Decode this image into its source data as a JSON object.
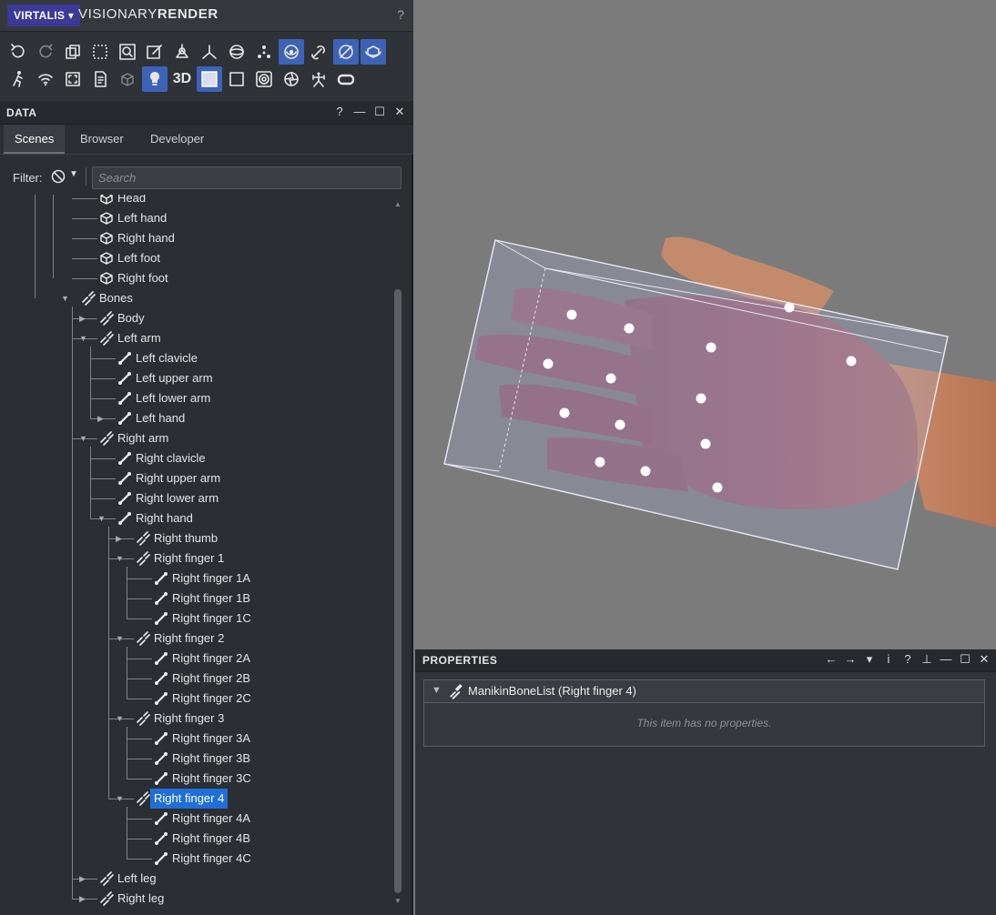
{
  "app": {
    "brand": "VIRTALIS",
    "brand_caret": "▾",
    "name_light": "VISIONARY",
    "name_bold": "RENDER",
    "help": "?"
  },
  "toolbar": {
    "row1": [
      "undo-icon",
      "redo-icon",
      "copy-icon",
      "marquee-select-icon",
      "zoom-select-icon",
      "edit-icon",
      "tree-icon",
      "axes-icon",
      "sphere-icon",
      "nodes-icon",
      "orbit-icon",
      "link-icon",
      "snap-icon",
      "cube-orbit-icon"
    ],
    "row1_active": [
      10,
      12,
      13
    ],
    "row2": [
      "walk-icon",
      "wifi-icon",
      "fit-icon",
      "document-icon",
      "box-icon",
      "light-icon",
      "3d-label",
      "solid-view-icon",
      "square-icon",
      "lens-icon",
      "shutter-icon",
      "skeleton-icon",
      "vr-headset-icon"
    ],
    "row2_active": [
      5,
      7
    ],
    "label_3d": "3D"
  },
  "data_panel": {
    "title": "DATA",
    "buttons": [
      "?",
      "—",
      "☐",
      "✕"
    ],
    "tabs": [
      {
        "label": "Scenes",
        "active": true
      },
      {
        "label": "Browser",
        "active": false
      },
      {
        "label": "Developer",
        "active": false
      }
    ],
    "filter_label": "Filter:",
    "search_placeholder": "Search"
  },
  "tree": [
    {
      "label": "Head",
      "icon": "mesh",
      "depth": 3,
      "arrow": ""
    },
    {
      "label": "Left hand",
      "icon": "mesh",
      "depth": 3,
      "arrow": ""
    },
    {
      "label": "Right hand",
      "icon": "mesh",
      "depth": 3,
      "arrow": ""
    },
    {
      "label": "Left foot",
      "icon": "mesh",
      "depth": 3,
      "arrow": ""
    },
    {
      "label": "Right foot",
      "icon": "mesh",
      "depth": 3,
      "arrow": ""
    },
    {
      "label": "Bones",
      "icon": "bonelist",
      "depth": 2,
      "arrow": "down"
    },
    {
      "label": "Body",
      "icon": "bonelist",
      "depth": 3,
      "arrow": "right"
    },
    {
      "label": "Left arm",
      "icon": "bonelist",
      "depth": 3,
      "arrow": "down"
    },
    {
      "label": "Left clavicle",
      "icon": "bone",
      "depth": 4,
      "arrow": ""
    },
    {
      "label": "Left upper arm",
      "icon": "bone",
      "depth": 4,
      "arrow": ""
    },
    {
      "label": "Left lower arm",
      "icon": "bone",
      "depth": 4,
      "arrow": ""
    },
    {
      "label": "Left hand",
      "icon": "bone",
      "depth": 4,
      "arrow": "right"
    },
    {
      "label": "Right arm",
      "icon": "bonelist",
      "depth": 3,
      "arrow": "down"
    },
    {
      "label": "Right clavicle",
      "icon": "bone",
      "depth": 4,
      "arrow": ""
    },
    {
      "label": "Right upper arm",
      "icon": "bone",
      "depth": 4,
      "arrow": ""
    },
    {
      "label": "Right lower arm",
      "icon": "bone",
      "depth": 4,
      "arrow": ""
    },
    {
      "label": "Right hand",
      "icon": "bone",
      "depth": 4,
      "arrow": "down"
    },
    {
      "label": "Right thumb",
      "icon": "bonelist",
      "depth": 5,
      "arrow": "right"
    },
    {
      "label": "Right finger 1",
      "icon": "bonelist",
      "depth": 5,
      "arrow": "down"
    },
    {
      "label": "Right finger 1A",
      "icon": "bone",
      "depth": 6,
      "arrow": ""
    },
    {
      "label": "Right finger 1B",
      "icon": "bone",
      "depth": 6,
      "arrow": ""
    },
    {
      "label": "Right finger 1C",
      "icon": "bone",
      "depth": 6,
      "arrow": ""
    },
    {
      "label": "Right finger 2",
      "icon": "bonelist",
      "depth": 5,
      "arrow": "down"
    },
    {
      "label": "Right finger 2A",
      "icon": "bone",
      "depth": 6,
      "arrow": ""
    },
    {
      "label": "Right finger 2B",
      "icon": "bone",
      "depth": 6,
      "arrow": ""
    },
    {
      "label": "Right finger 2C",
      "icon": "bone",
      "depth": 6,
      "arrow": ""
    },
    {
      "label": "Right finger 3",
      "icon": "bonelist",
      "depth": 5,
      "arrow": "down"
    },
    {
      "label": "Right finger 3A",
      "icon": "bone",
      "depth": 6,
      "arrow": ""
    },
    {
      "label": "Right finger 3B",
      "icon": "bone",
      "depth": 6,
      "arrow": ""
    },
    {
      "label": "Right finger 3C",
      "icon": "bone",
      "depth": 6,
      "arrow": ""
    },
    {
      "label": "Right finger 4",
      "icon": "bonelist",
      "depth": 5,
      "arrow": "down",
      "selected": true
    },
    {
      "label": "Right finger 4A",
      "icon": "bone",
      "depth": 6,
      "arrow": ""
    },
    {
      "label": "Right finger 4B",
      "icon": "bone",
      "depth": 6,
      "arrow": ""
    },
    {
      "label": "Right finger 4C",
      "icon": "bone",
      "depth": 6,
      "arrow": ""
    },
    {
      "label": "Left leg",
      "icon": "bonelist",
      "depth": 3,
      "arrow": "right"
    },
    {
      "label": "Right leg",
      "icon": "bonelist",
      "depth": 3,
      "arrow": "right"
    }
  ],
  "properties": {
    "title": "PROPERTIES",
    "buttons": [
      "←",
      "→",
      "▾",
      "i",
      "?",
      "⊥",
      "—",
      "☐",
      "✕"
    ],
    "item_title": "ManikinBoneList (Right finger 4)",
    "empty_message": "This item has no properties."
  },
  "colors": {
    "selection": "#1f6fd6",
    "brand_bg": "#3c3a96",
    "active_tool": "#3d63b8",
    "viewport_bg": "#7b7b7b"
  }
}
